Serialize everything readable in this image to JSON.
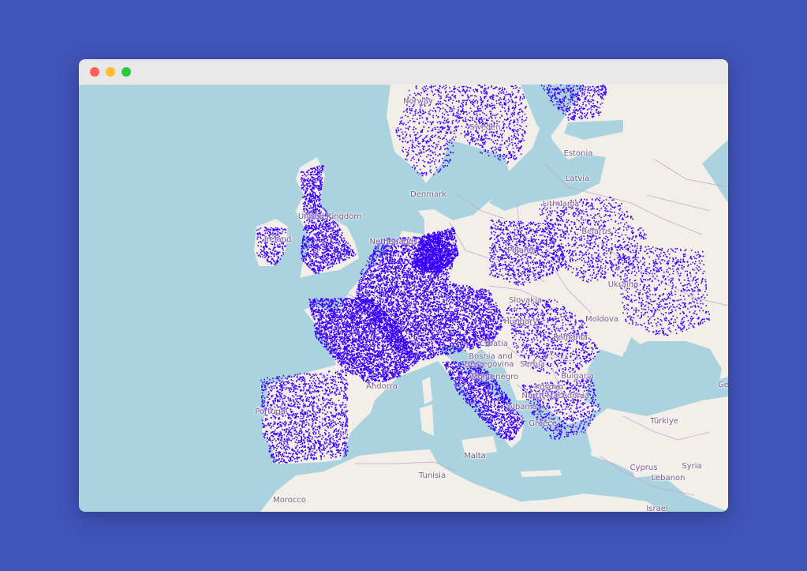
{
  "window": {
    "controls": [
      {
        "name": "close-button",
        "color": "#ff5f57"
      },
      {
        "name": "minimize-button",
        "color": "#febc2e"
      },
      {
        "name": "maximize-button",
        "color": "#28c840"
      }
    ]
  },
  "map": {
    "colors": {
      "water": "#aad3df",
      "land": "#f2efe9",
      "border": "#c9a5cf",
      "points": "#3a00ff"
    },
    "labels": [
      {
        "text": "Norway"
      },
      {
        "text": "Sweden"
      },
      {
        "text": "Estonia"
      },
      {
        "text": "Latvia"
      },
      {
        "text": "Lithuania"
      },
      {
        "text": "Denmark"
      },
      {
        "text": "United Kingdom"
      },
      {
        "text": "Ireland"
      },
      {
        "text": "Netherlands"
      },
      {
        "text": "Belarus"
      },
      {
        "text": "Poland"
      },
      {
        "text": "Ukraine"
      },
      {
        "text": "Slovakia"
      },
      {
        "text": "Hungary"
      },
      {
        "text": "Moldova"
      },
      {
        "text": "Romania"
      },
      {
        "text": "Croatia"
      },
      {
        "text": "Bosnia and"
      },
      {
        "text": "Herzegovina"
      },
      {
        "text": "Serbia"
      },
      {
        "text": "Montenegro"
      },
      {
        "text": "Bulgaria"
      },
      {
        "text": "Kosovo"
      },
      {
        "text": "North Macedonia"
      },
      {
        "text": "Albania"
      },
      {
        "text": "Andorra"
      },
      {
        "text": "Portugal"
      },
      {
        "text": "Greece"
      },
      {
        "text": "Türkiye"
      },
      {
        "text": "Malta"
      },
      {
        "text": "Tunisia"
      },
      {
        "text": "Morocco"
      },
      {
        "text": "Cyprus"
      },
      {
        "text": "Syria"
      },
      {
        "text": "Lebanon"
      },
      {
        "text": "Israel"
      },
      {
        "text": "Ge"
      }
    ]
  }
}
